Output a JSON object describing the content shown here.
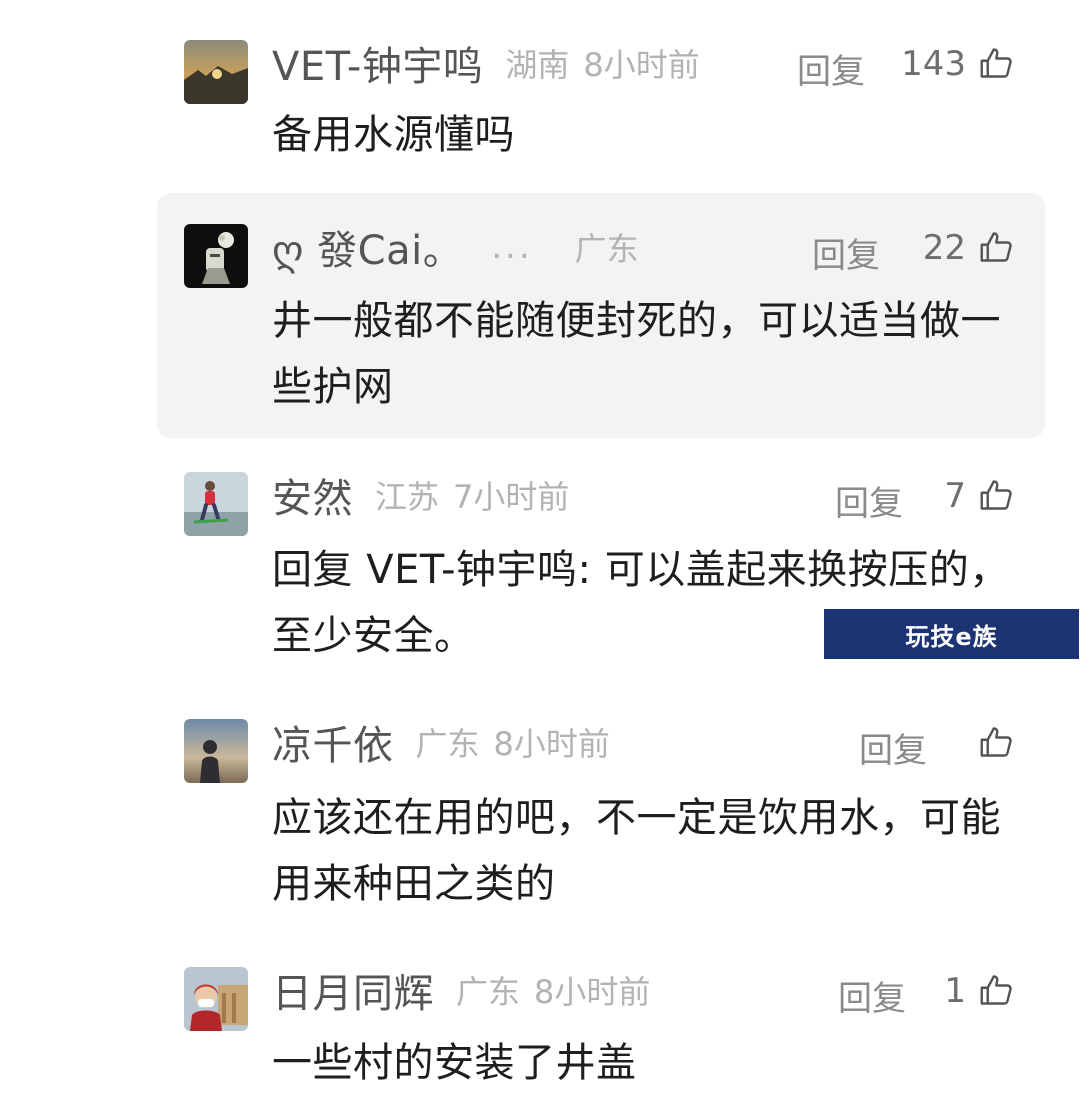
{
  "comments": [
    {
      "username": "VET-钟宇鸣",
      "location": "湖南",
      "time": "8小时前",
      "reply_label": "回复",
      "likes": "143",
      "text": "备用水源懂吗"
    },
    {
      "username": "ღ 發Cai。",
      "extra": "...",
      "location": "广东",
      "time": "",
      "reply_label": "回复",
      "likes": "22",
      "text": "井一般都不能随便封死的，可以适当做一些护网"
    },
    {
      "username": "安然",
      "location": "江苏",
      "time": "7小时前",
      "reply_label": "回复",
      "likes": "7",
      "reply_prefix": "回复",
      "mention": "VET-钟宇鸣:",
      "text": "可以盖起来换按压的，至少安全。"
    },
    {
      "username": "凉千依",
      "location": "广东",
      "time": "8小时前",
      "reply_label": "回复",
      "likes": "",
      "text": "应该还在用的吧，不一定是饮用水，可能用来种田之类的"
    },
    {
      "username": "日月同辉",
      "location": "广东",
      "time": "8小时前",
      "reply_label": "回复",
      "likes": "1",
      "text": "一些村的安装了井盖"
    }
  ],
  "watermark": {
    "text": "玩技e族"
  },
  "icons": {
    "like": "thumbs-up-icon"
  },
  "colors": {
    "reply_background": "#f3f3f3",
    "watermark_background": "#1d3474"
  }
}
